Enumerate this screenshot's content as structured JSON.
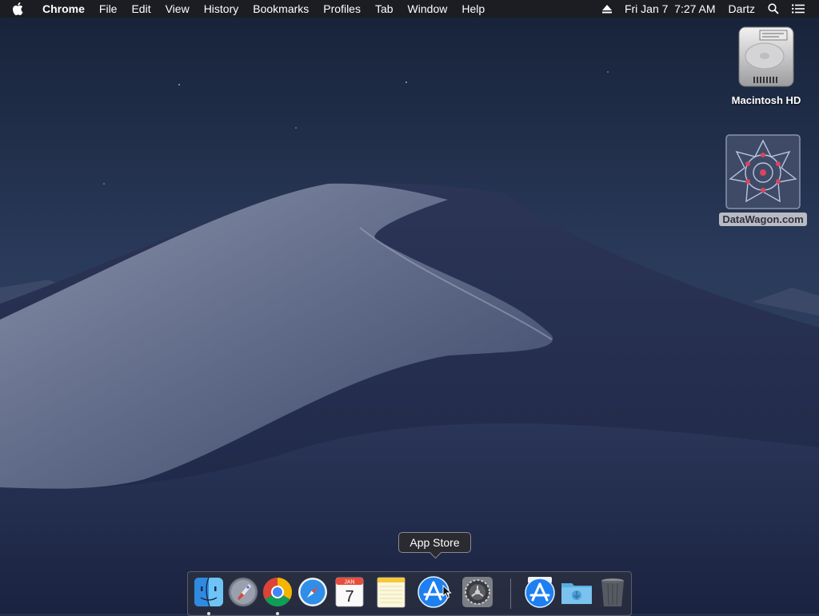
{
  "menubar": {
    "apple_icon": "apple-icon",
    "app_name": "Chrome",
    "items": [
      "File",
      "Edit",
      "View",
      "History",
      "Bookmarks",
      "Profiles",
      "Tab",
      "Window",
      "Help"
    ],
    "eject_icon": "eject-icon",
    "datetime": "Fri Jan 7  7:27 AM",
    "user": "Dartz",
    "search_icon": "spotlight-search-icon",
    "menu_icon": "notification-center-icon"
  },
  "desktop": {
    "icons": [
      {
        "label": "Macintosh HD",
        "icon": "hard-drive-icon"
      },
      {
        "label": "DataWagon.com",
        "icon": "datawagon-logo-icon"
      }
    ]
  },
  "tooltip": {
    "text": "App Store"
  },
  "dock": {
    "calendar_month": "JAN",
    "calendar_day": "7",
    "items": [
      {
        "name": "Finder",
        "icon": "finder-icon",
        "running": true
      },
      {
        "name": "Launchpad",
        "icon": "launchpad-icon",
        "running": false
      },
      {
        "name": "Google Chrome",
        "icon": "chrome-icon",
        "running": true
      },
      {
        "name": "Safari",
        "icon": "safari-icon",
        "running": false
      },
      {
        "name": "Calendar",
        "icon": "calendar-icon",
        "running": false
      },
      {
        "name": "Notes",
        "icon": "notes-icon",
        "running": false
      },
      {
        "name": "App Store",
        "icon": "app-store-icon",
        "running": false
      },
      {
        "name": "System Preferences",
        "icon": "system-preferences-icon",
        "running": false
      },
      {
        "name": "App Store",
        "icon": "app-store-icon",
        "running": false
      },
      {
        "name": "Downloads",
        "icon": "downloads-folder-icon",
        "running": false
      },
      {
        "name": "Trash",
        "icon": "trash-icon",
        "running": false
      }
    ]
  }
}
